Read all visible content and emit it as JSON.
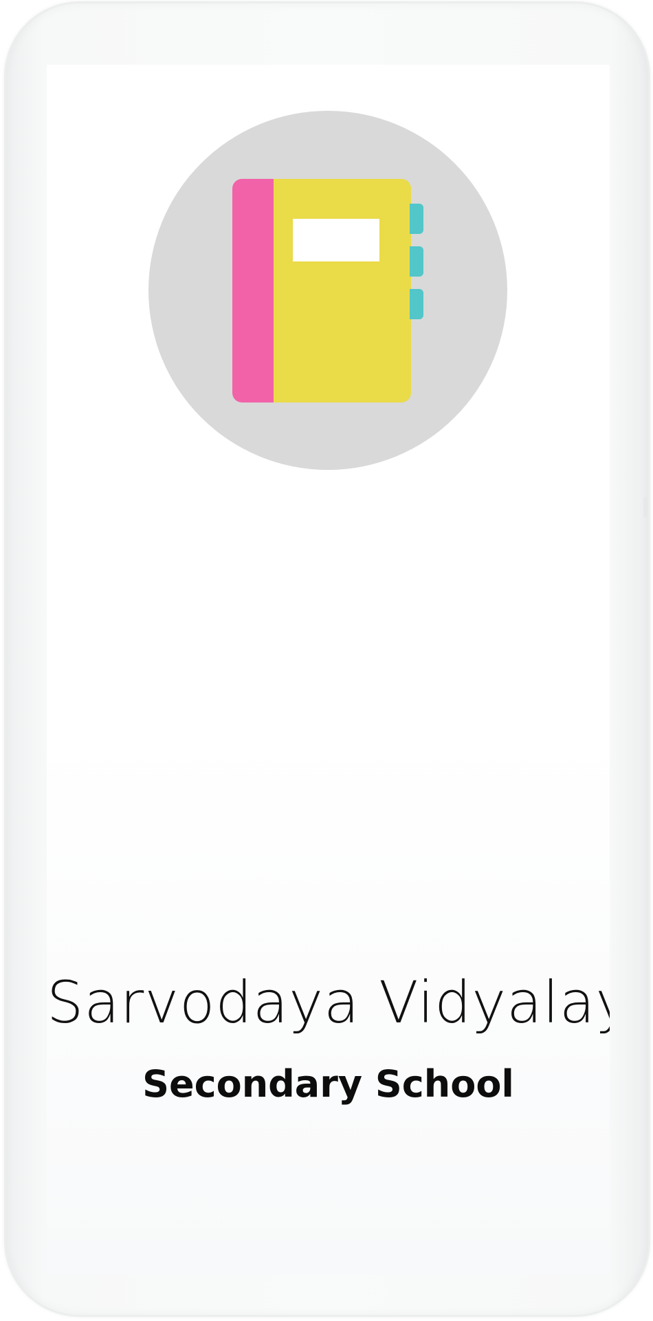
{
  "app": {
    "school_name": "Sarvodaya Vidyalaya",
    "subtitle": "Secondary School"
  },
  "logo": {
    "icon": "notebook-icon",
    "circle_color": "#d9d9d9",
    "notebook_colors": {
      "spine": "#f262a8",
      "cover": "#eadb48",
      "tabs": "#52c6c9",
      "label": "#ffffff"
    }
  }
}
